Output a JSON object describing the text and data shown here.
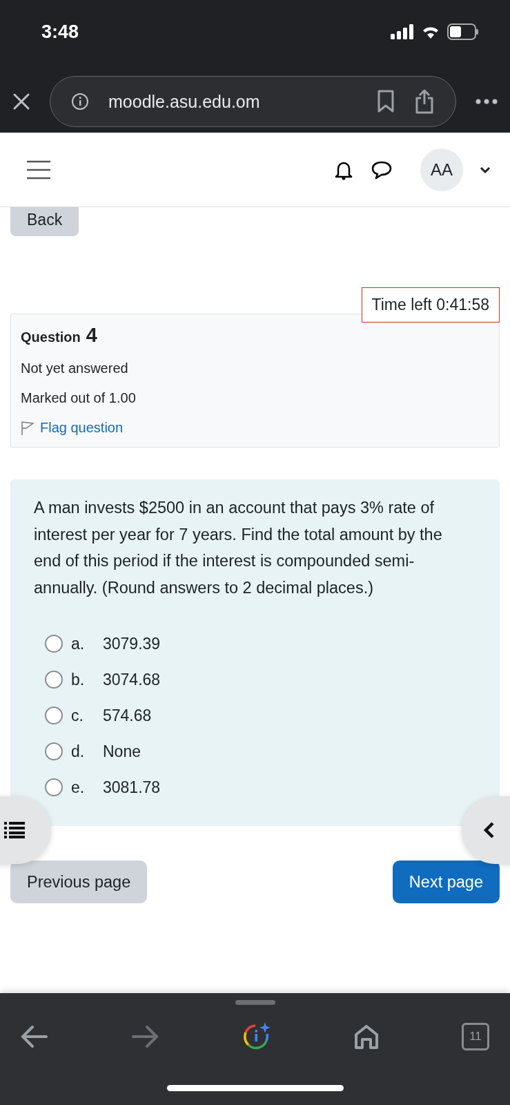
{
  "status_bar": {
    "time": "3:48"
  },
  "browser": {
    "url": "moodle.asu.edu.om",
    "tab_count": "11"
  },
  "header": {
    "avatar": "AA"
  },
  "back_button": "Back",
  "timer": "Time left 0:41:58",
  "question_info": {
    "label": "Question",
    "number": "4",
    "state": "Not yet answered",
    "marks": "Marked out of 1.00",
    "flag": "Flag question"
  },
  "question": {
    "text": "A man invests $2500 in an account that pays 3% rate of interest per year for 7 years. Find the total amount by the end of this period if the interest is compounded semi-annually. (Round answers to 2 decimal places.)",
    "options": [
      {
        "letter": "a.",
        "answer": "3079.39",
        "selected": false
      },
      {
        "letter": "b.",
        "answer": "3074.68",
        "selected": false
      },
      {
        "letter": "c.",
        "answer": "574.68",
        "selected": false
      },
      {
        "letter": "d.",
        "answer": "None",
        "selected": false
      },
      {
        "letter": "e.",
        "answer": "3081.78",
        "selected": false
      }
    ]
  },
  "navigation": {
    "previous": "Previous page",
    "next": "Next page"
  }
}
